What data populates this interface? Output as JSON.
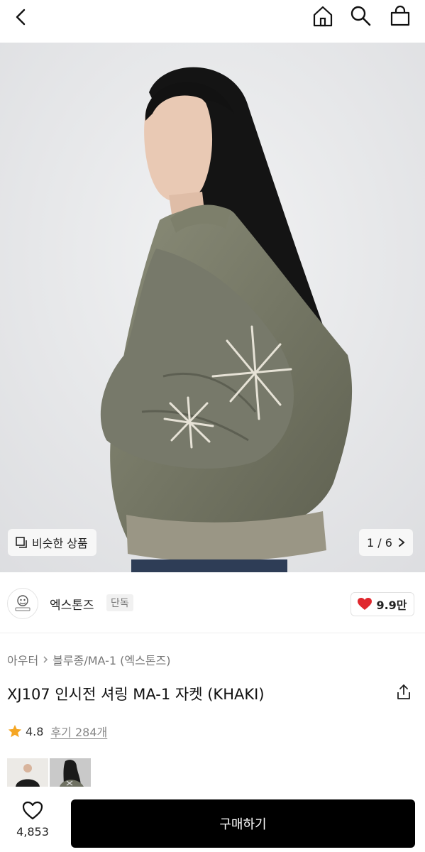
{
  "header": {
    "icons": [
      "back-icon",
      "home-icon",
      "search-icon",
      "shopping-bag-icon"
    ]
  },
  "hero": {
    "similar_label": "비슷한 상품",
    "pager": "1 / 6"
  },
  "brand": {
    "name": "엑스톤즈",
    "tag": "단독",
    "likes": "9.9만"
  },
  "breadcrumb": {
    "items": [
      "아우터",
      "블루종/MA-1 (엑스톤즈)"
    ]
  },
  "product": {
    "title": "XJ107 인시전 셔링 MA-1 자켓 (KHAKI)",
    "rating": "4.8",
    "reviews": "후기 284개"
  },
  "bottom": {
    "fav_count": "4,853",
    "buy_label": "구매하기"
  },
  "colors": {
    "accent_red": "#e0272d",
    "star": "#f5a623",
    "button_bg": "#000000"
  }
}
